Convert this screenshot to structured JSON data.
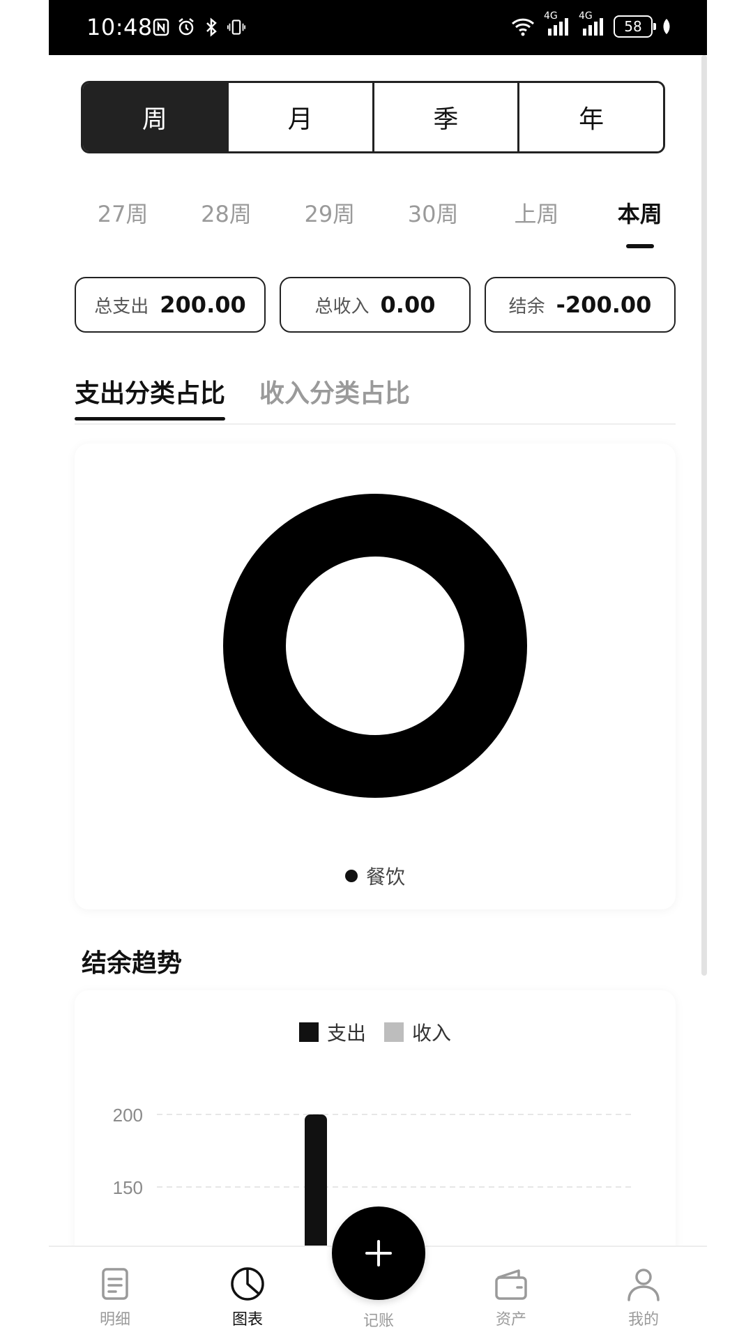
{
  "status_bar": {
    "time": "10:48",
    "battery": "58",
    "net1": "4G",
    "net2": "4G"
  },
  "period_tabs": [
    "周",
    "月",
    "季",
    "年"
  ],
  "period_active": 0,
  "week_tabs": [
    "27周",
    "28周",
    "29周",
    "30周",
    "上周",
    "本周"
  ],
  "week_active": 5,
  "summary": {
    "expense_label": "总支出",
    "expense_value": "200.00",
    "income_label": "总收入",
    "income_value": "0.00",
    "balance_label": "结余",
    "balance_value": "-200.00"
  },
  "category_tabs": {
    "expense": "支出分类占比",
    "income": "收入分类占比"
  },
  "chart_data": [
    {
      "type": "pie",
      "variant": "donut",
      "categories": [
        "餐饮"
      ],
      "values": [
        200
      ],
      "colors": [
        "#000000"
      ],
      "legend": [
        "餐饮"
      ]
    },
    {
      "type": "bar",
      "title": "结余趋势",
      "legend": [
        "支出",
        "收入"
      ],
      "colors": {
        "支出": "#111111",
        "收入": "#bdbdbd"
      },
      "y_ticks": [
        "200",
        "150"
      ],
      "series": [
        {
          "name": "支出",
          "values": [
            200
          ]
        },
        {
          "name": "收入",
          "values": [
            0
          ]
        }
      ],
      "ylim": [
        0,
        200
      ]
    }
  ],
  "trend": {
    "title": "结余趋势"
  },
  "fab": {
    "label": "记账"
  },
  "nav": [
    {
      "label": "明细",
      "icon": "document-icon"
    },
    {
      "label": "图表",
      "icon": "pie-chart-icon"
    },
    {
      "label": "资产",
      "icon": "wallet-icon"
    },
    {
      "label": "我的",
      "icon": "user-icon"
    }
  ],
  "nav_active": 1
}
